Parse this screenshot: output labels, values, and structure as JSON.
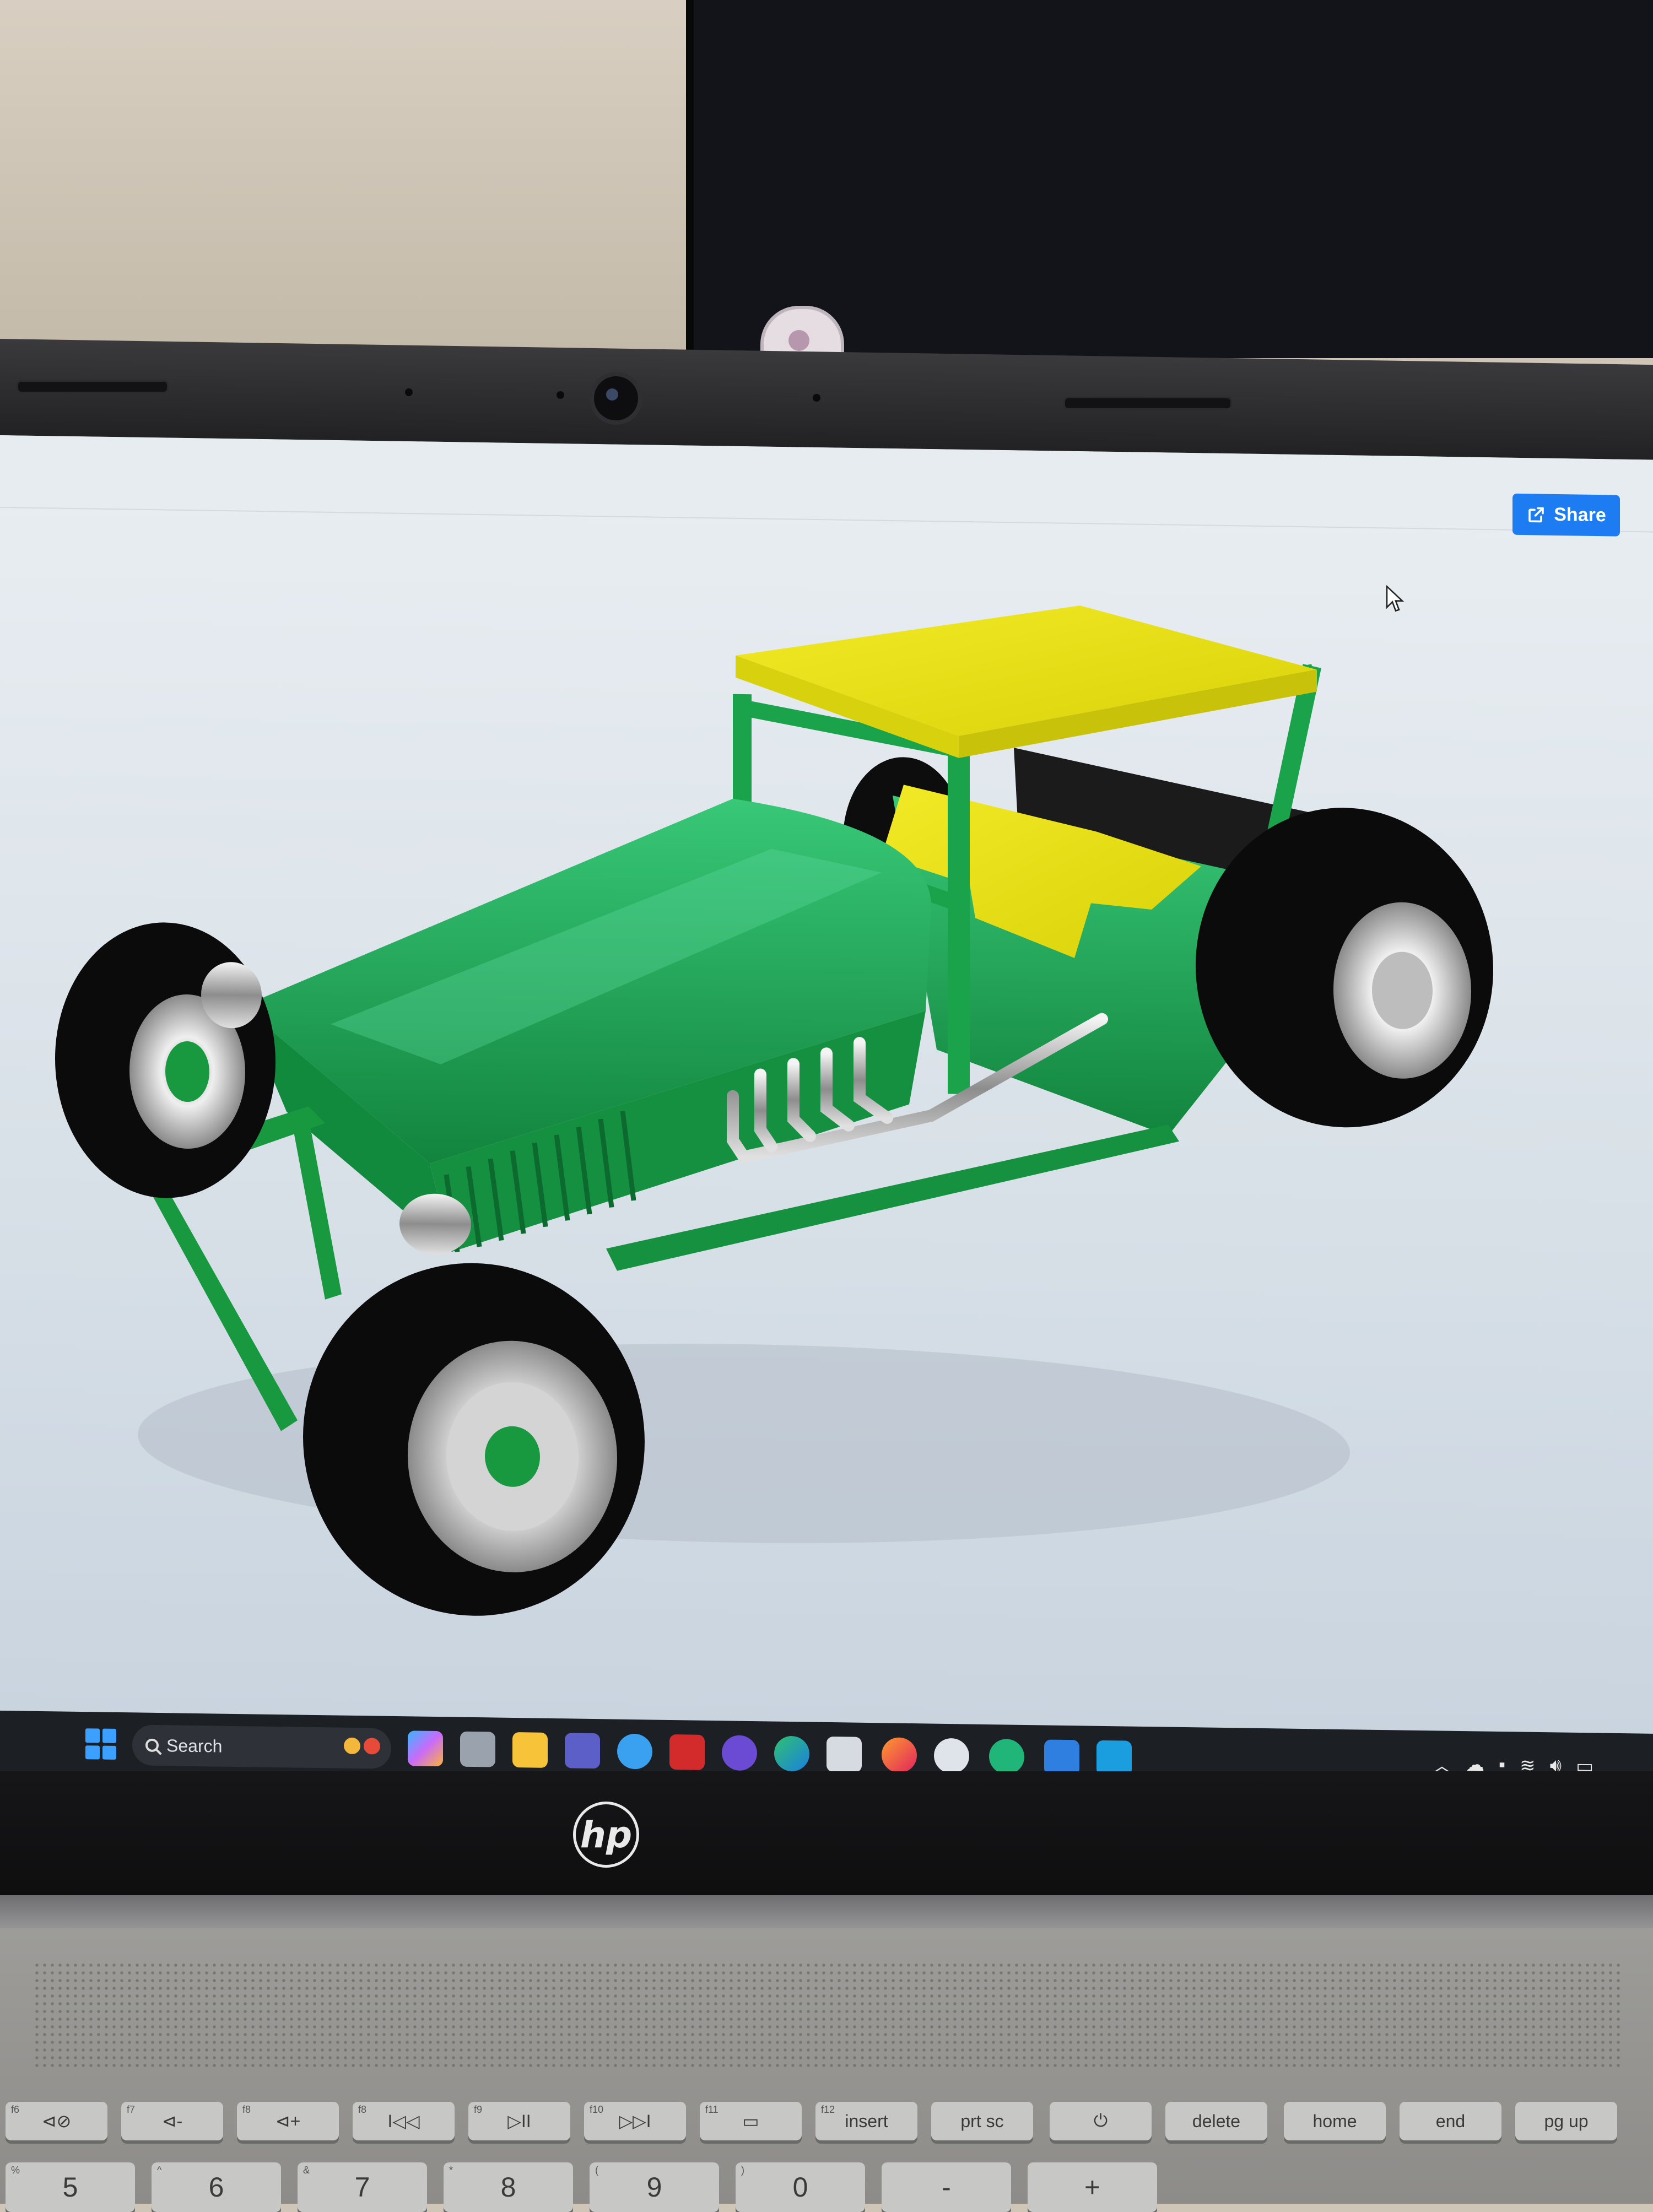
{
  "app": {
    "share_label": "Share",
    "icons": {
      "share": "share-icon",
      "cursor": "mouse-pointer-icon"
    }
  },
  "model": {
    "description_colors": {
      "body": "#19a04a",
      "roof_and_seat": "#e6e014",
      "tires": "#0b0b0b",
      "chrome": "#c8c8c8"
    }
  },
  "taskbar": {
    "search_placeholder": "Search",
    "apps": [
      "start-icon",
      "search-icon",
      "copilot-icon",
      "task-view-icon",
      "file-explorer-icon",
      "teams-icon",
      "help-icon",
      "mcafee-icon",
      "app-icon",
      "edge-icon",
      "microsoft-store-icon",
      "firefox-icon",
      "steam-icon",
      "app-icon-green",
      "onshape-icon",
      "app-icon-blue"
    ],
    "tray_icons": [
      "chevron-up-icon",
      "cloud-icon",
      "notification-icon",
      "wifi-icon",
      "volume-icon",
      "battery-icon"
    ]
  },
  "laptop": {
    "brand": "hp"
  },
  "keyboard": {
    "fn_row": [
      {
        "label": "⊲⊘",
        "sub": "f6"
      },
      {
        "label": "⊲-",
        "sub": "f7"
      },
      {
        "label": "⊲+",
        "sub": "f8"
      },
      {
        "label": "I◁◁",
        "sub": "f8"
      },
      {
        "label": "▷II",
        "sub": "f9"
      },
      {
        "label": "▷▷I",
        "sub": "f10"
      },
      {
        "label": "▭",
        "sub": "f11"
      },
      {
        "label": "insert",
        "sub": "f12"
      },
      {
        "label": "prt sc",
        "sub": ""
      },
      {
        "label": "⏻",
        "sub": ""
      },
      {
        "label": "delete",
        "sub": ""
      },
      {
        "label": "home",
        "sub": ""
      },
      {
        "label": "end",
        "sub": ""
      },
      {
        "label": "pg up",
        "sub": ""
      }
    ],
    "num_row": [
      {
        "label": "5",
        "sub": "%"
      },
      {
        "label": "6",
        "sub": "^"
      },
      {
        "label": "7",
        "sub": "&"
      },
      {
        "label": "8",
        "sub": "*"
      },
      {
        "label": "9",
        "sub": "("
      },
      {
        "label": "0",
        "sub": ")"
      },
      {
        "label": "-",
        "sub": ""
      },
      {
        "label": "+",
        "sub": ""
      }
    ]
  }
}
